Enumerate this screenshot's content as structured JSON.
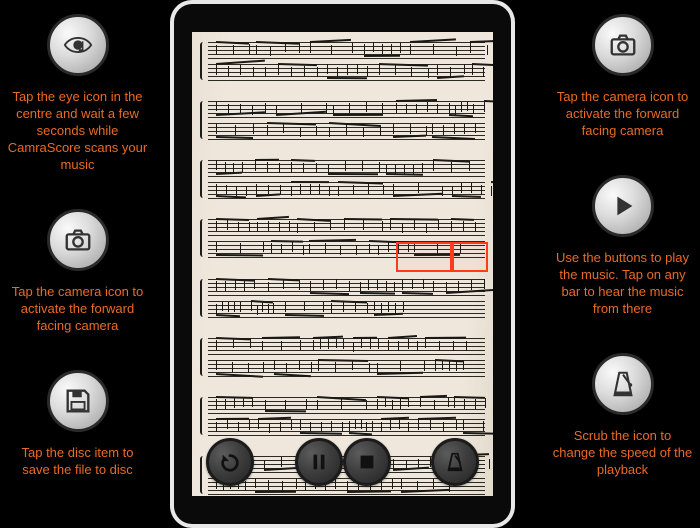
{
  "instructions": {
    "left": [
      {
        "name": "eye",
        "text": "Tap the eye icon in the centre and wait a few seconds while CamraScore scans your music"
      },
      {
        "name": "camera",
        "text": "Tap the camera icon to activate the forward facing camera"
      },
      {
        "name": "disc",
        "text": "Tap the disc item to save the file to disc"
      }
    ],
    "right": [
      {
        "name": "camera",
        "text": "Tap the camera icon to activate the forward facing camera"
      },
      {
        "name": "play",
        "text": "Use the buttons to play the music. Tap on any bar to hear the music from there"
      },
      {
        "name": "metronome",
        "text": "Scrub the icon to change the speed of the playback"
      }
    ]
  },
  "controls": [
    "undo",
    "pause",
    "stop",
    "metronome"
  ],
  "staff_systems": 8
}
